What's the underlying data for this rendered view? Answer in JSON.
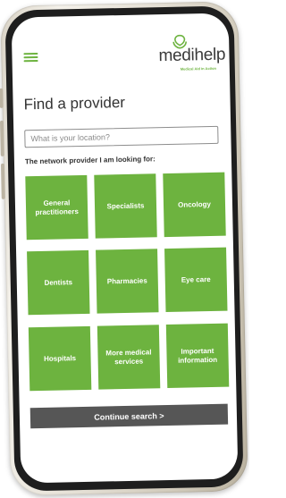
{
  "app": {
    "logo_name": "medihelp",
    "logo_tagline": "Medical Aid in Action"
  },
  "page": {
    "title": "Find a provider",
    "search_placeholder": "What is your location?",
    "subtitle": "The network provider I am looking for:"
  },
  "tiles": [
    {
      "label": "General practitioners"
    },
    {
      "label": "Specialists"
    },
    {
      "label": "Oncology"
    },
    {
      "label": "Dentists"
    },
    {
      "label": "Pharmacies"
    },
    {
      "label": "Eye care"
    },
    {
      "label": "Hospitals"
    },
    {
      "label": "More medical services"
    },
    {
      "label": "Important information"
    }
  ],
  "actions": {
    "continue_label": "Continue search >"
  },
  "colors": {
    "accent": "#6db33f",
    "button": "#565656",
    "text": "#333333"
  },
  "icons": {
    "menu": "hamburger-menu-icon",
    "logo": "medihelp-logo-mark"
  }
}
